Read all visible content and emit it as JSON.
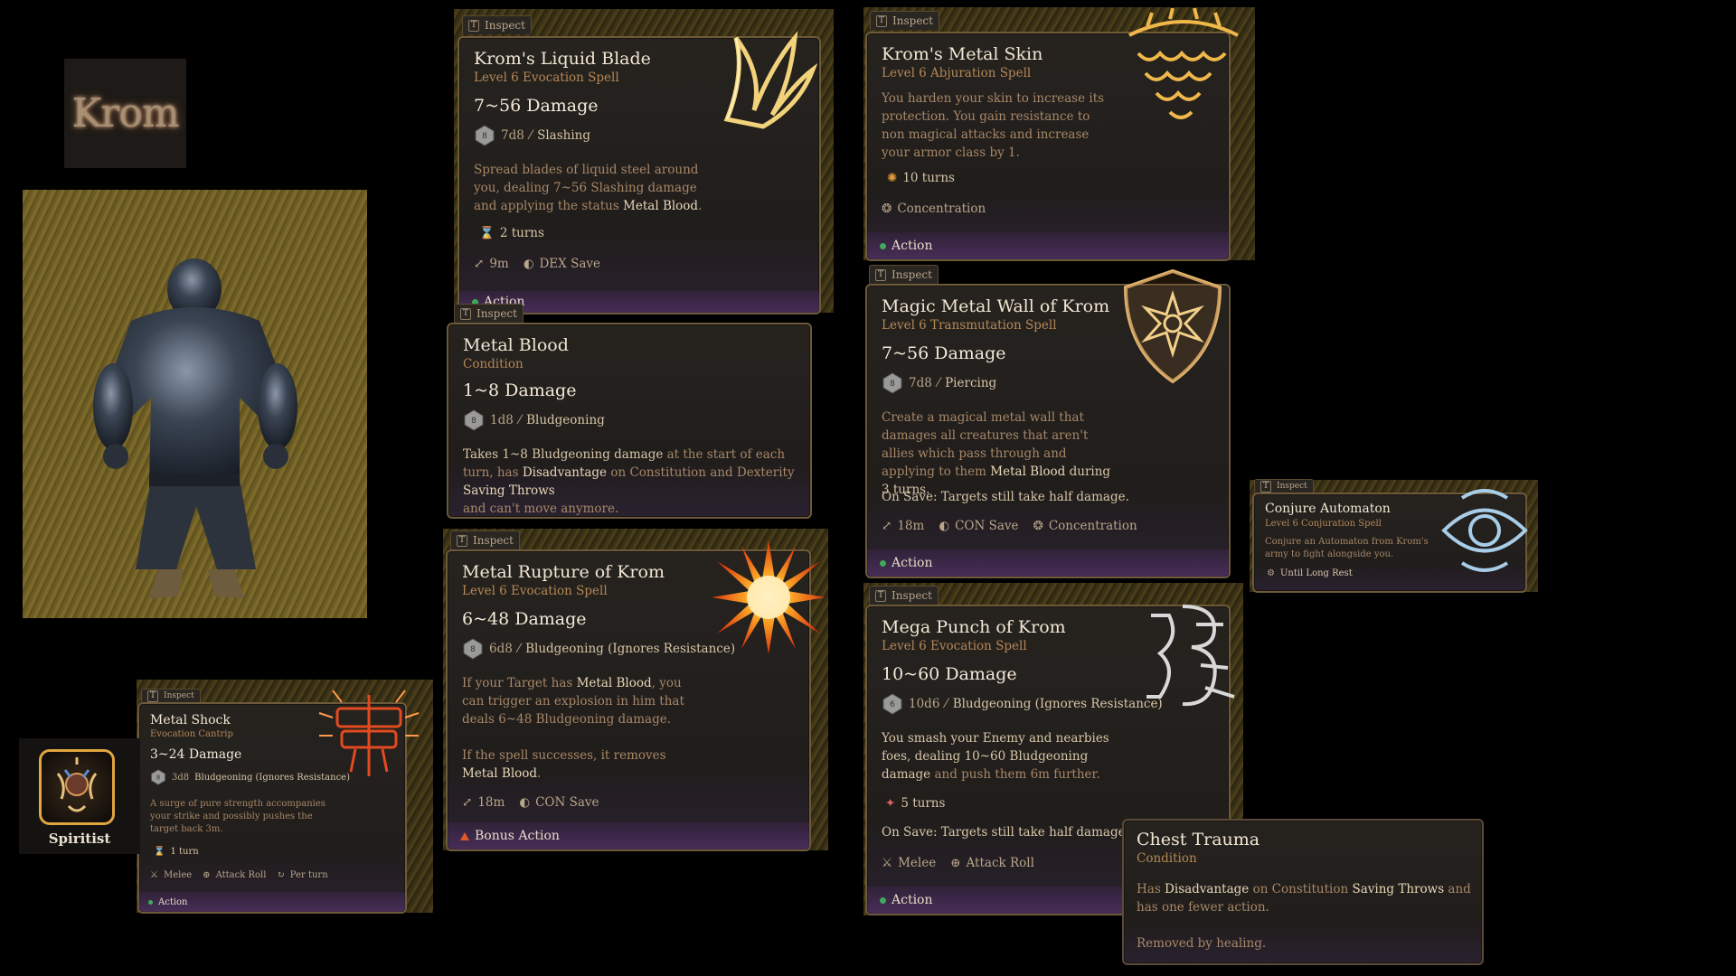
{
  "character": {
    "name": "Krom",
    "class_name": "Spiritist"
  },
  "tab_label": "Inspect",
  "tab_key": "T",
  "dice_label": "8",
  "dice_label_d6": "6",
  "cards": {
    "liquid_blade": {
      "name": "Krom's Liquid Blade",
      "subtitle": "Level 6 Evocation Spell",
      "damage": "7~56 Damage",
      "dice": "7d8",
      "dtype": "Slashing",
      "desc_1": "Spread blades of liquid steel around you, dealing 7~56 Slashing damage and applying the status ",
      "desc_hl": "Metal Blood",
      "desc_2": ".",
      "turns": "2 turns",
      "range": "9m",
      "save": "DEX Save",
      "action": "Action"
    },
    "metal_skin": {
      "name": "Krom's Metal Skin",
      "subtitle": "Level 6 Abjuration Spell",
      "desc": "You harden your skin to increase its protection. You gain resistance to non magical attacks and increase your armor class by 1.",
      "turns": "10 turns",
      "concentration": "Concentration",
      "action": "Action"
    },
    "metal_blood": {
      "name": "Metal Blood",
      "subtitle": "Condition",
      "damage": "1~8 Damage",
      "dice": "1d8",
      "dtype": "Bludgeoning",
      "desc_1": "Takes 1~8 Bludgeoning damage",
      "desc_2": " at the start of each turn, has ",
      "desc_hl1": "Disadvantage",
      "desc_3": " on Constitution and Dexterity ",
      "desc_hl2": "Saving Throws",
      "desc_4": "and can't move anymore."
    },
    "metal_wall": {
      "name": "Magic Metal Wall of Krom",
      "subtitle": "Level 6 Transmutation Spell",
      "damage": "7~56 Damage",
      "dice": "7d8",
      "dtype": "Piercing",
      "desc_1": "Create a magical metal wall that damages all creatures that aren't allies which pass through and applying to them ",
      "desc_hl": "Metal Blood",
      "desc_2": " during 3 turns.",
      "on_save": "On Save: Targets still take half damage.",
      "range": "18m",
      "save": "CON Save",
      "concentration": "Concentration",
      "action": "Action"
    },
    "conjure": {
      "name": "Conjure Automaton",
      "subtitle": "Level 6 Conjuration Spell",
      "desc": "Conjure an Automaton from Krom's army to fight alongside you.",
      "duration": "Until Long Rest"
    },
    "rupture": {
      "name": "Metal Rupture of Krom",
      "subtitle": "Level 6 Evocation Spell",
      "damage": "6~48 Damage",
      "dice": "6d8",
      "dtype": "Bludgeoning (Ignores Resistance)",
      "desc_1": "If your Target has ",
      "desc_hl1": "Metal Blood",
      "desc_2": ", you can trigger an explosion in him that deals 6~48 Bludgeoning damage.",
      "desc_3": "If the spell successes, it removes ",
      "desc_hl2": "Metal Blood",
      "desc_4": ".",
      "range": "18m",
      "save": "CON Save",
      "action": "Bonus Action"
    },
    "metal_shock": {
      "name": "Metal Shock",
      "subtitle": "Evocation Cantrip",
      "damage": "3~24 Damage",
      "dice": "3d8",
      "dtype": "Bludgeoning (Ignores Resistance)",
      "desc": "A surge of pure strength accompanies your strike and possibly pushes the target back 3m.",
      "turns": "1 turn",
      "melee": "Melee",
      "attack": "Attack Roll",
      "per_turn": "Per turn",
      "action": "Action"
    },
    "mega_punch": {
      "name": "Mega Punch of Krom",
      "subtitle": "Level 6 Evocation Spell",
      "damage": "10~60 Damage",
      "dice": "10d6",
      "dtype": "Bludgeoning (Ignores Resistance)",
      "desc_1": "You smash your Enemy and nearbies foes, dealing 10~60 Bludgeoning damage",
      "desc_2": " and push them 6m further.",
      "turns": "5 turns",
      "on_save": "On Save: Targets still take half damage.",
      "melee": "Melee",
      "attack": "Attack Roll",
      "action": "Action"
    },
    "chest_trauma": {
      "name": "Chest Trauma",
      "subtitle": "Condition",
      "desc_1": "Has ",
      "desc_hl1": "Disadvantage",
      "desc_2": " on Constitution ",
      "desc_hl2": "Saving Throws",
      "desc_3": " and has one fewer action.",
      "removed": "Removed by healing."
    }
  },
  "colors": {
    "accent_gold": "#e9c46a",
    "condition_orange": "#b58756",
    "action_green": "#3faa5a",
    "bonus_orange": "#e25a2a",
    "frame_olive": "#4a3e18"
  }
}
